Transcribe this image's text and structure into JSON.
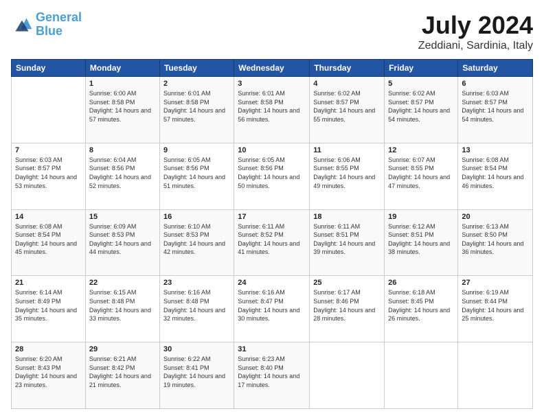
{
  "header": {
    "logo_line1": "General",
    "logo_line2": "Blue",
    "month_year": "July 2024",
    "location": "Zeddiani, Sardinia, Italy"
  },
  "days_of_week": [
    "Sunday",
    "Monday",
    "Tuesday",
    "Wednesday",
    "Thursday",
    "Friday",
    "Saturday"
  ],
  "weeks": [
    [
      {
        "day": "",
        "sunrise": "",
        "sunset": "",
        "daylight": ""
      },
      {
        "day": "1",
        "sunrise": "Sunrise: 6:00 AM",
        "sunset": "Sunset: 8:58 PM",
        "daylight": "Daylight: 14 hours and 57 minutes."
      },
      {
        "day": "2",
        "sunrise": "Sunrise: 6:01 AM",
        "sunset": "Sunset: 8:58 PM",
        "daylight": "Daylight: 14 hours and 57 minutes."
      },
      {
        "day": "3",
        "sunrise": "Sunrise: 6:01 AM",
        "sunset": "Sunset: 8:58 PM",
        "daylight": "Daylight: 14 hours and 56 minutes."
      },
      {
        "day": "4",
        "sunrise": "Sunrise: 6:02 AM",
        "sunset": "Sunset: 8:57 PM",
        "daylight": "Daylight: 14 hours and 55 minutes."
      },
      {
        "day": "5",
        "sunrise": "Sunrise: 6:02 AM",
        "sunset": "Sunset: 8:57 PM",
        "daylight": "Daylight: 14 hours and 54 minutes."
      },
      {
        "day": "6",
        "sunrise": "Sunrise: 6:03 AM",
        "sunset": "Sunset: 8:57 PM",
        "daylight": "Daylight: 14 hours and 54 minutes."
      }
    ],
    [
      {
        "day": "7",
        "sunrise": "Sunrise: 6:03 AM",
        "sunset": "Sunset: 8:57 PM",
        "daylight": "Daylight: 14 hours and 53 minutes."
      },
      {
        "day": "8",
        "sunrise": "Sunrise: 6:04 AM",
        "sunset": "Sunset: 8:56 PM",
        "daylight": "Daylight: 14 hours and 52 minutes."
      },
      {
        "day": "9",
        "sunrise": "Sunrise: 6:05 AM",
        "sunset": "Sunset: 8:56 PM",
        "daylight": "Daylight: 14 hours and 51 minutes."
      },
      {
        "day": "10",
        "sunrise": "Sunrise: 6:05 AM",
        "sunset": "Sunset: 8:56 PM",
        "daylight": "Daylight: 14 hours and 50 minutes."
      },
      {
        "day": "11",
        "sunrise": "Sunrise: 6:06 AM",
        "sunset": "Sunset: 8:55 PM",
        "daylight": "Daylight: 14 hours and 49 minutes."
      },
      {
        "day": "12",
        "sunrise": "Sunrise: 6:07 AM",
        "sunset": "Sunset: 8:55 PM",
        "daylight": "Daylight: 14 hours and 47 minutes."
      },
      {
        "day": "13",
        "sunrise": "Sunrise: 6:08 AM",
        "sunset": "Sunset: 8:54 PM",
        "daylight": "Daylight: 14 hours and 46 minutes."
      }
    ],
    [
      {
        "day": "14",
        "sunrise": "Sunrise: 6:08 AM",
        "sunset": "Sunset: 8:54 PM",
        "daylight": "Daylight: 14 hours and 45 minutes."
      },
      {
        "day": "15",
        "sunrise": "Sunrise: 6:09 AM",
        "sunset": "Sunset: 8:53 PM",
        "daylight": "Daylight: 14 hours and 44 minutes."
      },
      {
        "day": "16",
        "sunrise": "Sunrise: 6:10 AM",
        "sunset": "Sunset: 8:53 PM",
        "daylight": "Daylight: 14 hours and 42 minutes."
      },
      {
        "day": "17",
        "sunrise": "Sunrise: 6:11 AM",
        "sunset": "Sunset: 8:52 PM",
        "daylight": "Daylight: 14 hours and 41 minutes."
      },
      {
        "day": "18",
        "sunrise": "Sunrise: 6:11 AM",
        "sunset": "Sunset: 8:51 PM",
        "daylight": "Daylight: 14 hours and 39 minutes."
      },
      {
        "day": "19",
        "sunrise": "Sunrise: 6:12 AM",
        "sunset": "Sunset: 8:51 PM",
        "daylight": "Daylight: 14 hours and 38 minutes."
      },
      {
        "day": "20",
        "sunrise": "Sunrise: 6:13 AM",
        "sunset": "Sunset: 8:50 PM",
        "daylight": "Daylight: 14 hours and 36 minutes."
      }
    ],
    [
      {
        "day": "21",
        "sunrise": "Sunrise: 6:14 AM",
        "sunset": "Sunset: 8:49 PM",
        "daylight": "Daylight: 14 hours and 35 minutes."
      },
      {
        "day": "22",
        "sunrise": "Sunrise: 6:15 AM",
        "sunset": "Sunset: 8:48 PM",
        "daylight": "Daylight: 14 hours and 33 minutes."
      },
      {
        "day": "23",
        "sunrise": "Sunrise: 6:16 AM",
        "sunset": "Sunset: 8:48 PM",
        "daylight": "Daylight: 14 hours and 32 minutes."
      },
      {
        "day": "24",
        "sunrise": "Sunrise: 6:16 AM",
        "sunset": "Sunset: 8:47 PM",
        "daylight": "Daylight: 14 hours and 30 minutes."
      },
      {
        "day": "25",
        "sunrise": "Sunrise: 6:17 AM",
        "sunset": "Sunset: 8:46 PM",
        "daylight": "Daylight: 14 hours and 28 minutes."
      },
      {
        "day": "26",
        "sunrise": "Sunrise: 6:18 AM",
        "sunset": "Sunset: 8:45 PM",
        "daylight": "Daylight: 14 hours and 26 minutes."
      },
      {
        "day": "27",
        "sunrise": "Sunrise: 6:19 AM",
        "sunset": "Sunset: 8:44 PM",
        "daylight": "Daylight: 14 hours and 25 minutes."
      }
    ],
    [
      {
        "day": "28",
        "sunrise": "Sunrise: 6:20 AM",
        "sunset": "Sunset: 8:43 PM",
        "daylight": "Daylight: 14 hours and 23 minutes."
      },
      {
        "day": "29",
        "sunrise": "Sunrise: 6:21 AM",
        "sunset": "Sunset: 8:42 PM",
        "daylight": "Daylight: 14 hours and 21 minutes."
      },
      {
        "day": "30",
        "sunrise": "Sunrise: 6:22 AM",
        "sunset": "Sunset: 8:41 PM",
        "daylight": "Daylight: 14 hours and 19 minutes."
      },
      {
        "day": "31",
        "sunrise": "Sunrise: 6:23 AM",
        "sunset": "Sunset: 8:40 PM",
        "daylight": "Daylight: 14 hours and 17 minutes."
      },
      {
        "day": "",
        "sunrise": "",
        "sunset": "",
        "daylight": ""
      },
      {
        "day": "",
        "sunrise": "",
        "sunset": "",
        "daylight": ""
      },
      {
        "day": "",
        "sunrise": "",
        "sunset": "",
        "daylight": ""
      }
    ]
  ]
}
